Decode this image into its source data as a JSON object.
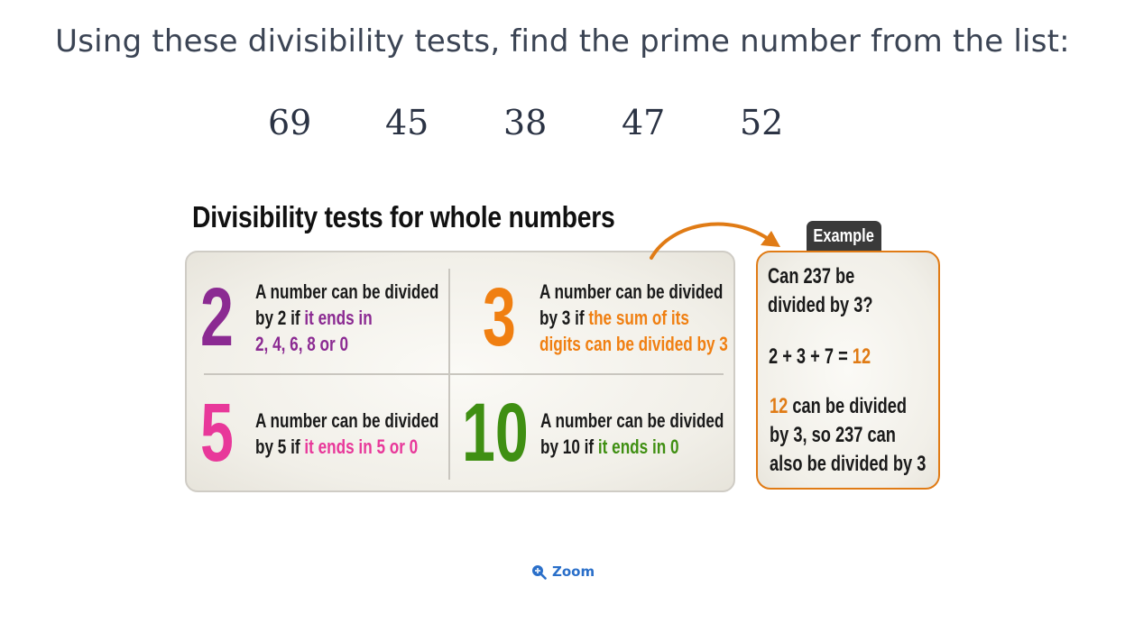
{
  "question": "Using these divisibility tests, find the prime number from the list:",
  "numbers": [
    "69",
    "45",
    "38",
    "47",
    "52"
  ],
  "figure": {
    "heading": "Divisibility tests for whole numbers",
    "rules": [
      {
        "digit": "2",
        "color": "#8b2a92",
        "line1": "A number can be divided",
        "line2_pre": "by 2 if ",
        "line2_hl": "it ends in",
        "line3_hl": "2, 4, 6, 8 or 0"
      },
      {
        "digit": "3",
        "color": "#f07f11",
        "line1": "A number can be divided",
        "line2_pre": "by 3 if ",
        "line2_hl": "the sum of its",
        "line3_hl": "digits can be divided by 3"
      },
      {
        "digit": "5",
        "color": "#e8389a",
        "line1": "A number can be divided",
        "line2_pre": "by 5 if ",
        "line2_hl": "it ends in 5 or 0"
      },
      {
        "digit": "10",
        "color": "#3f8f12",
        "line1": "A number can be divided",
        "line2_pre": "by 10 if ",
        "line2_hl": "it ends in 0"
      }
    ],
    "example": {
      "tag": "Example",
      "q1": "Can 237 be",
      "q2": "divided by 3?",
      "sum_expr": "2 + 3 + 7 = ",
      "sum_result": "12",
      "c1_num": "12",
      "c1_rest": " can be divided",
      "c2": "by 3, so 237 can",
      "c3": "also be divided by 3",
      "accent": "#e07b15"
    }
  },
  "zoom": {
    "label": "Zoom",
    "icon": "zoom-in-icon",
    "color": "#2a6fc9"
  }
}
